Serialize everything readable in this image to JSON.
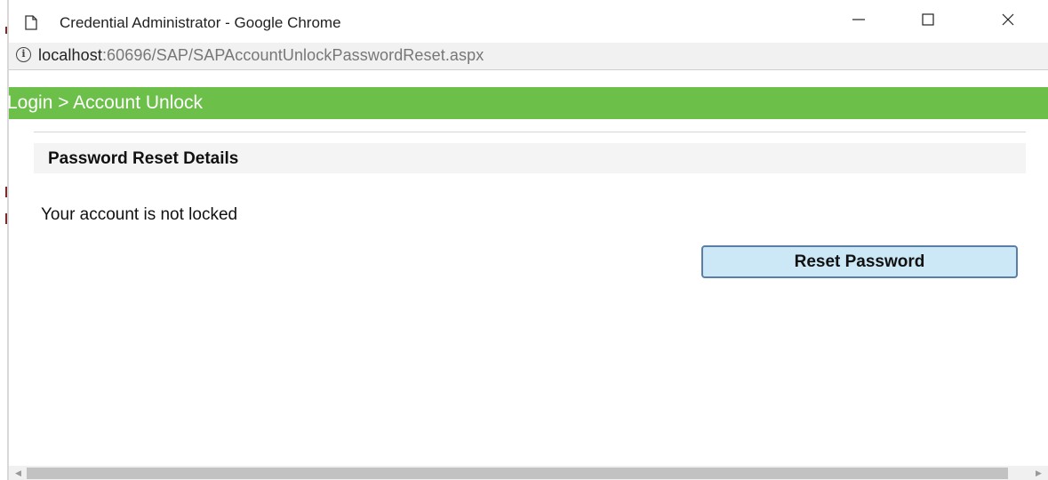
{
  "window": {
    "title": "Credential Administrator - Google Chrome",
    "icon": "page-icon",
    "controls": [
      "minimize-icon",
      "maximize-icon",
      "close-icon"
    ]
  },
  "addressbar": {
    "icon": "info-icon",
    "url_host": "localhost",
    "url_path": ":60696/SAP/SAPAccountUnlockPasswordReset.aspx"
  },
  "header": {
    "breadcrumb": "Login > Account Unlock",
    "bar_color": "#6cc04a"
  },
  "section": {
    "title": "Password Reset Details"
  },
  "main": {
    "status_message": "Your account is not locked",
    "reset_button": "Reset Password",
    "button_color": "#cce8f7"
  },
  "scrollbar": {
    "left_arrow": "◀",
    "right_arrow": "▶"
  }
}
